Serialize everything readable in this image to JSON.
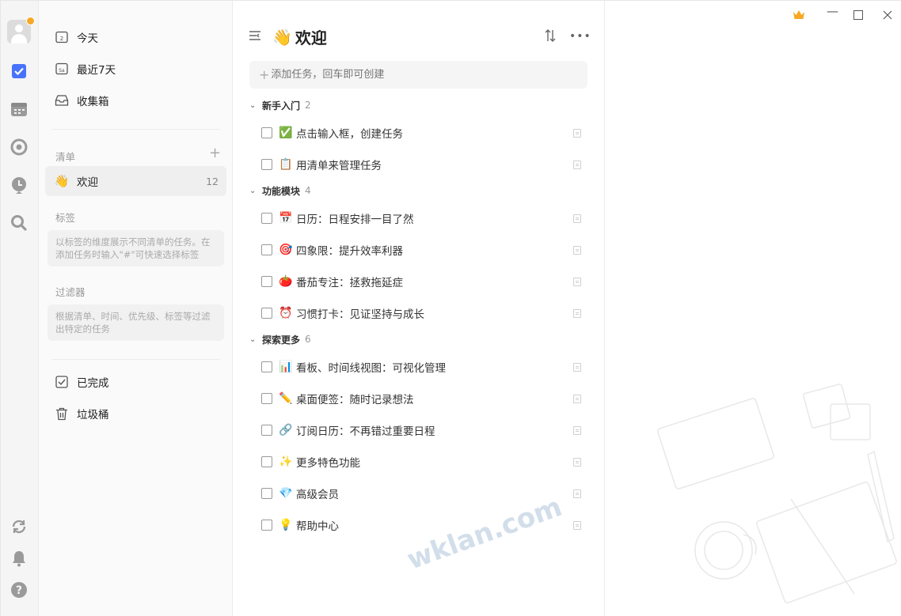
{
  "sidebar": {
    "icons": [
      "avatar",
      "checkbox-icon",
      "calendar-icon",
      "focus-icon",
      "pomodoro-icon",
      "search-icon",
      "sync-icon",
      "bell-icon",
      "help-icon"
    ]
  },
  "nav": {
    "smart_lists": [
      {
        "label": "今天",
        "icon": "calendar-today-icon"
      },
      {
        "label": "最近7天",
        "icon": "calendar-week-icon"
      },
      {
        "label": "收集箱",
        "icon": "inbox-icon"
      }
    ],
    "lists_title": "清单",
    "lists": [
      {
        "label": "欢迎",
        "emoji": "👋",
        "count": "12"
      }
    ],
    "tags_title": "标签",
    "tags_hint": "以标签的维度展示不同清单的任务。在添加任务时输入\"#\"可快速选择标签",
    "filters_title": "过滤器",
    "filters_hint": "根据清单、时间、优先级、标签等过滤出特定的任务",
    "bottom": [
      {
        "label": "已完成",
        "icon": "completed-icon"
      },
      {
        "label": "垃圾桶",
        "icon": "trash-icon"
      }
    ]
  },
  "main": {
    "title": "欢迎",
    "title_emoji": "👋",
    "add_placeholder": "添加任务，回车即可创建",
    "groups": [
      {
        "name": "新手入门",
        "count": "2",
        "tasks": [
          {
            "emoji": "✅",
            "label": "点击输入框，创建任务"
          },
          {
            "emoji": "📋",
            "label": "用清单来管理任务"
          }
        ]
      },
      {
        "name": "功能模块",
        "count": "4",
        "tasks": [
          {
            "emoji": "📅",
            "label": "日历：日程安排一目了然"
          },
          {
            "emoji": "🎯",
            "label": "四象限：提升效率利器"
          },
          {
            "emoji": "🍅",
            "label": "番茄专注：拯救拖延症"
          },
          {
            "emoji": "⏰",
            "label": "习惯打卡：见证坚持与成长"
          }
        ]
      },
      {
        "name": "探索更多",
        "count": "6",
        "tasks": [
          {
            "emoji": "📊",
            "label": "看板、时间线视图：可视化管理"
          },
          {
            "emoji": "✏️",
            "label": "桌面便签：随时记录想法"
          },
          {
            "emoji": "🔗",
            "label": "订阅日历：不再错过重要日程"
          },
          {
            "emoji": "✨",
            "label": "更多特色功能"
          },
          {
            "emoji": "💎",
            "label": "高级会员"
          },
          {
            "emoji": "💡",
            "label": "帮助中心"
          }
        ]
      }
    ]
  },
  "colors": {
    "accent": "#4772fa",
    "crown": "#f7a823"
  },
  "watermark": "wklan.com"
}
